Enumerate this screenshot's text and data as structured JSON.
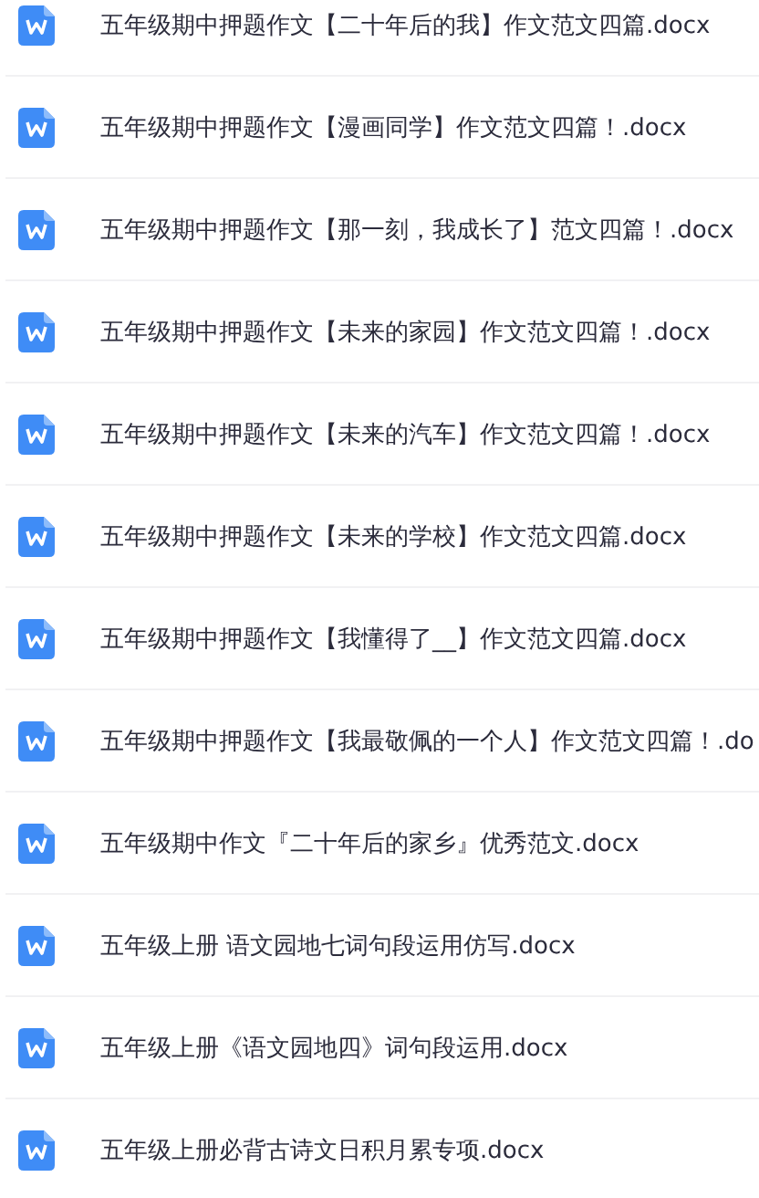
{
  "files": [
    {
      "name": "五年级期中押题作文【二十年后的我】作文范文四篇.docx"
    },
    {
      "name": "五年级期中押题作文【漫画同学】作文范文四篇！.docx"
    },
    {
      "name": "五年级期中押题作文【那一刻，我成长了】范文四篇！.docx"
    },
    {
      "name": "五年级期中押题作文【未来的家园】作文范文四篇！.docx"
    },
    {
      "name": "五年级期中押题作文【未来的汽车】作文范文四篇！.docx"
    },
    {
      "name": "五年级期中押题作文【未来的学校】作文范文四篇.docx"
    },
    {
      "name": "五年级期中押题作文【我懂得了__】作文范文四篇.docx"
    },
    {
      "name": "五年级期中押题作文【我最敬佩的一个人】作文范文四篇！.do"
    },
    {
      "name": "五年级期中作文『二十年后的家乡』优秀范文.docx"
    },
    {
      "name": "五年级上册 语文园地七词句段运用仿写.docx"
    },
    {
      "name": "五年级上册《语文园地四》词句段运用.docx"
    },
    {
      "name": "五年级上册必背古诗文日积月累专项.docx"
    }
  ]
}
